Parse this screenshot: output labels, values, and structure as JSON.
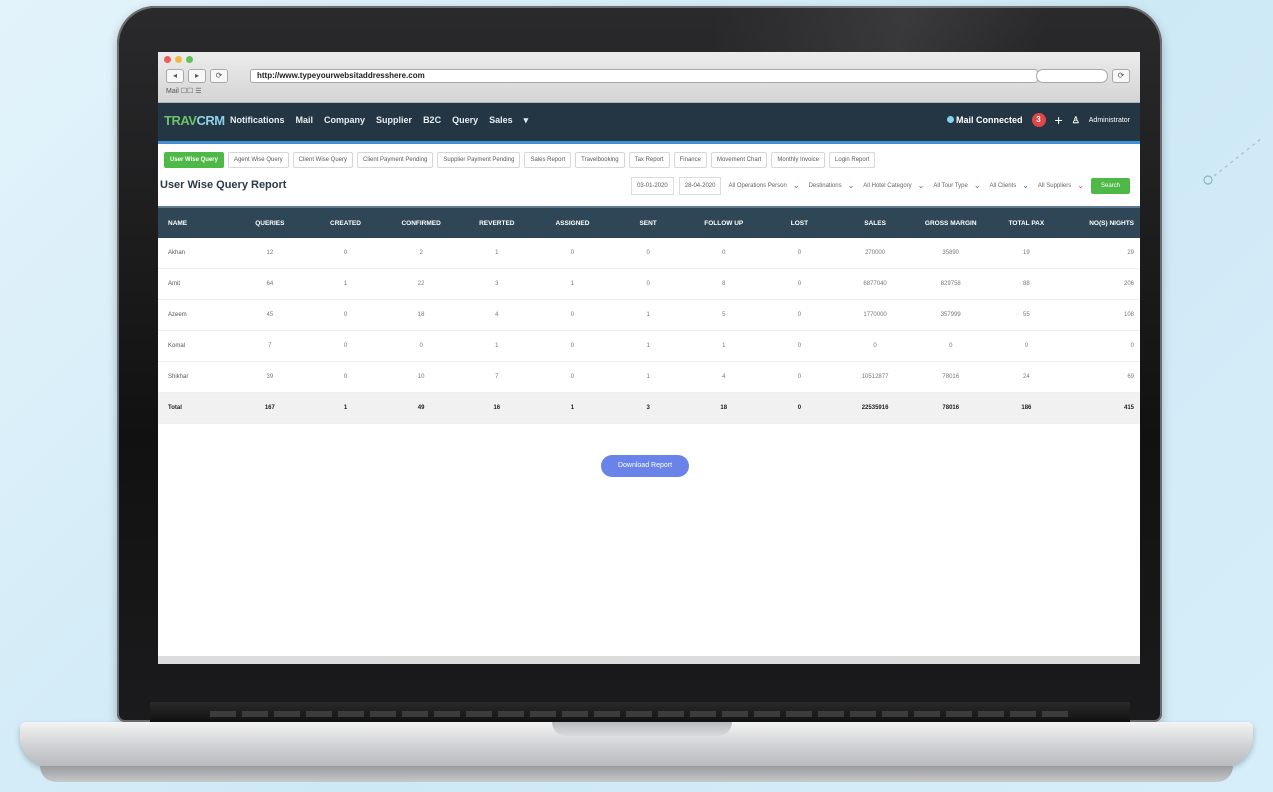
{
  "browser": {
    "url": "http://www.typeyourwebsitaddresshere.com",
    "nav_buttons": [
      "◂",
      "▸",
      "⟳"
    ],
    "bookmarks": "Mail  ☐☐  ☰"
  },
  "app": {
    "logo_prefix": "TRAV",
    "logo_suffix": "CRM",
    "menu": [
      "Notifications",
      "Mail",
      "Company",
      "Supplier",
      "B2C",
      "Query",
      "Sales"
    ],
    "more_icon": "chevron-down-icon",
    "mail_status": "Mail Connected",
    "notification_count": "3",
    "user_name": "Administrator"
  },
  "tabs": [
    {
      "label": "User Wise Query",
      "active": true
    },
    {
      "label": "Agent Wise Query"
    },
    {
      "label": "Client Wise Query"
    },
    {
      "label": "Client Payment Pending"
    },
    {
      "label": "Supplier Payment Pending"
    },
    {
      "label": "Sales Report"
    },
    {
      "label": "Travelbooking"
    },
    {
      "label": "Tax Report"
    },
    {
      "label": "Finance"
    },
    {
      "label": "Movement Chart"
    },
    {
      "label": "Monthly Invoice"
    },
    {
      "label": "Login Report"
    }
  ],
  "filters": {
    "title": "User Wise Query Report",
    "start_date": "03-01-2020",
    "end_date": "28-04-2020",
    "selects": [
      "All Operations Person",
      "Destinations",
      "All Hotel Category",
      "All Tour Type",
      "All Clients",
      "All Suppliers"
    ],
    "search_label": "Search"
  },
  "table": {
    "headers": [
      "NAME",
      "QUERIES",
      "CREATED",
      "CONFIRMED",
      "REVERTED",
      "ASSIGNED",
      "SENT",
      "FOLLOW UP",
      "LOST",
      "SALES",
      "GROSS MARGIN",
      "TOTAL PAX",
      "NO(S) NIGHTS"
    ],
    "rows": [
      [
        "Akhan",
        "12",
        "0",
        "2",
        "1",
        "0",
        "0",
        "0",
        "0",
        "270000",
        "35890",
        "19",
        "29"
      ],
      [
        "Amit",
        "64",
        "1",
        "22",
        "3",
        "1",
        "0",
        "8",
        "0",
        "6877040",
        "829758",
        "88",
        "206"
      ],
      [
        "Azeem",
        "45",
        "0",
        "18",
        "4",
        "0",
        "1",
        "5",
        "0",
        "1770000",
        "357999",
        "55",
        "108"
      ],
      [
        "Komal",
        "7",
        "0",
        "0",
        "1",
        "0",
        "1",
        "1",
        "0",
        "0",
        "0",
        "0",
        "0"
      ],
      [
        "Shikhar",
        "39",
        "0",
        "10",
        "7",
        "0",
        "1",
        "4",
        "0",
        "10512877",
        "78016",
        "24",
        "69"
      ]
    ],
    "total": [
      "Total",
      "167",
      "1",
      "49",
      "16",
      "1",
      "3",
      "18",
      "0",
      "22535916",
      "78016",
      "186",
      "415"
    ]
  },
  "download_label": "Download Report"
}
